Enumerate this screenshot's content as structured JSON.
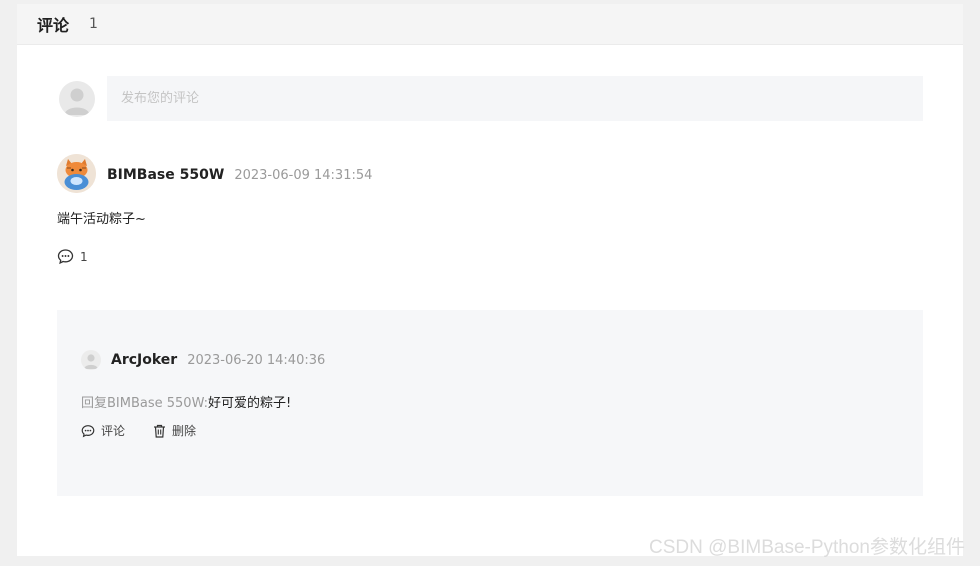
{
  "header": {
    "title": "评论",
    "count": "1"
  },
  "composer": {
    "placeholder": "发布您的评论"
  },
  "comment": {
    "username": "BIMBase 550W",
    "time": "2023-06-09 14:31:54",
    "text": "端午活动粽子~",
    "reply_count": "1",
    "icon": "comment-bubble-icon"
  },
  "reply": {
    "username": "ArcJoker",
    "time": "2023-06-20 14:40:36",
    "prefix": "回复BIMBase 550W:",
    "text": "好可爱的粽子!",
    "actions": {
      "comment_label": "评论",
      "delete_label": "删除"
    }
  },
  "watermark": "CSDN @BIMBase-Python参数化组件",
  "colors": {
    "panel_bg": "#ffffff",
    "page_bg": "#f0f0f0",
    "reply_bg": "#f6f7f9",
    "muted_text": "#9a9a9a"
  }
}
